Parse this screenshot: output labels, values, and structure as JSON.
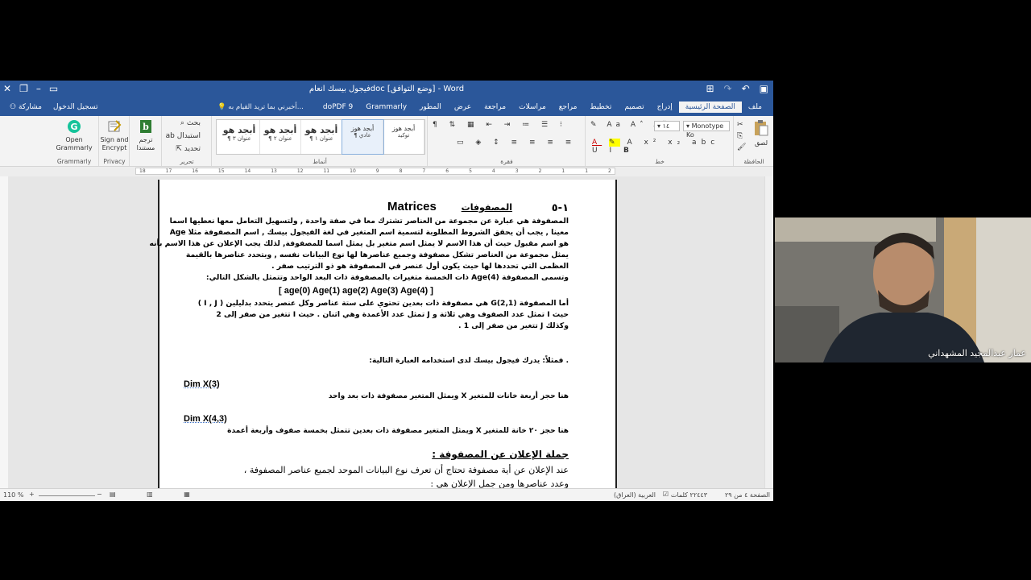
{
  "window": {
    "title": "فيجول بيسك انعامdoc [وضع التوافق] - Word"
  },
  "tabs": [
    "ملف",
    "الصفحة الرئيسية",
    "إدراج",
    "تصميم",
    "تخطيط",
    "مراجع",
    "مراسلات",
    "مراجعة",
    "عرض",
    "المطور",
    "Grammarly",
    "doPDF 9"
  ],
  "active_tab": "الصفحة الرئيسية",
  "tell_me": "أخبرني بما تريد القيام به...",
  "signin": "تسجيل الدخول",
  "share": "مشاركة",
  "ribbon": {
    "clipboard": {
      "paste": "لصق",
      "label": "الحافظة"
    },
    "font": {
      "name": "Monotype Ko",
      "size": "١٤",
      "label": "خط"
    },
    "paragraph": {
      "label": "فقرة"
    },
    "styles": {
      "label": "أنماط",
      "items": [
        {
          "big": "أبجد هوز",
          "small": "توكيد"
        },
        {
          "big": "أبجد هوز",
          "small": "¶ عادي"
        },
        {
          "big": "أبجد هو",
          "small": "¶ عنوان ١"
        },
        {
          "big": "أبجد هو",
          "small": "¶ عنوان ٢"
        },
        {
          "big": "أبجد هو",
          "small": "¶ عنوان ٣"
        }
      ]
    },
    "editing": {
      "find": "بحث",
      "replace": "استبدال",
      "select": "تحديد",
      "label": "تحرير"
    },
    "translate": {
      "label": "ترجم مستندا"
    },
    "privacy": {
      "button": "Sign and Encrypt",
      "label": "Privacy"
    },
    "grammarly": {
      "button": "Open Grammarly",
      "label": "Grammarly"
    }
  },
  "ruler": [
    "18",
    "17",
    "16",
    "15",
    "14",
    "13",
    "12",
    "11",
    "10",
    "9",
    "8",
    "7",
    "6",
    "5",
    "4",
    "3",
    "2",
    "1",
    "1",
    "2"
  ],
  "document": {
    "heading_num": "١-٥",
    "heading_ar": "المصفوفات",
    "heading_en": "Matrices",
    "p1": [
      "المصفوفة هي عبارة عن مجموعة  من العناصر تشترك معا في صفة واحدة , ولتسهيل التعامل معها نعطيها اسما",
      "معينا , يجب أن يحقق الشروط المطلوبة لتسمية اسم المتغير في لغة الفيجول بيسك , اسم المصفوفة مثلا   Age",
      "هو اسم مقبول حيث أن هذا الاسم لا يمثل اسم متغير بل يمثل اسما للمصفوفة, لذلك يجب الإعلان عن هذا الاسم بأنه",
      "يمثل مجموعة من العناصر تشكل مصفوفة  وجميع عناصرها لها نوع البيانات نفسه , وبتحدد عناصرها بالقيمة",
      "العظمى التي تحددها لها حيث يكون أول عنصر في المصفوفة هو ذو الترتيب  صفر .",
      "وتسمى المصفوفة     Age(4)   ذات الخمسة متغيرات بالمصفوفة ذات البعد الواحد وتتمثل بالشكل التالي:"
    ],
    "array_line": "[ age(0)  Age(1)  age(2) Age(3) Age(4) ]",
    "p2": [
      "أما المصفوفة     G(2,1)     هي مصفوفة ذات بعدين تحتوي على ستة عناصر  وكل عنصر يتحدد بدليلين  ( I , J )",
      "حيث  I  تمثل عدد الصفوف وهي ثلاثة  و   J   تمثل عدد الأعمدة  وهي اثنان . حيث   I  تتغير  من صفر  إلى 2",
      "وكذلك J  تتغير من صفر إلى  1 ."
    ],
    "example_intro": ". فمثلاً: يدرك فيجول بيسك لدى استخدامه العبارة التالية:",
    "code1": "Dim  X(3)",
    "code1_desc": "هنا حجز أربعة خانات للمتغير   X   ويمثل المتغير مصفوفة ذات بعد واحد",
    "code2": "Dim  X(4,3)",
    "code2_desc": "هنا حجز ٢٠  خانة للمتغير   X   ويمثل المتغير مصفوفة ذات بعدين تتمثل بخمسة صفوف وأربعة أعمدة",
    "decl_heading": "جملة الإعلان عن المصفوفة :",
    "decl_1": "عند الإعلان عن أية مصفوفة  تحتاج أن تعرف نوع البيانات  الموحد لجميع عناصر المصفوفة ،",
    "decl_2": "وعدد عناصرها  ومن جمل الإعلان هي :"
  },
  "status": {
    "page": "الصفحة ٤ من ٢٩",
    "words": "٢٢٤٤٣ كلمات",
    "language": "العربية (العراق)",
    "zoom": "110 %"
  },
  "video": {
    "name": "عمار عبدالمجيد المشهداني"
  }
}
